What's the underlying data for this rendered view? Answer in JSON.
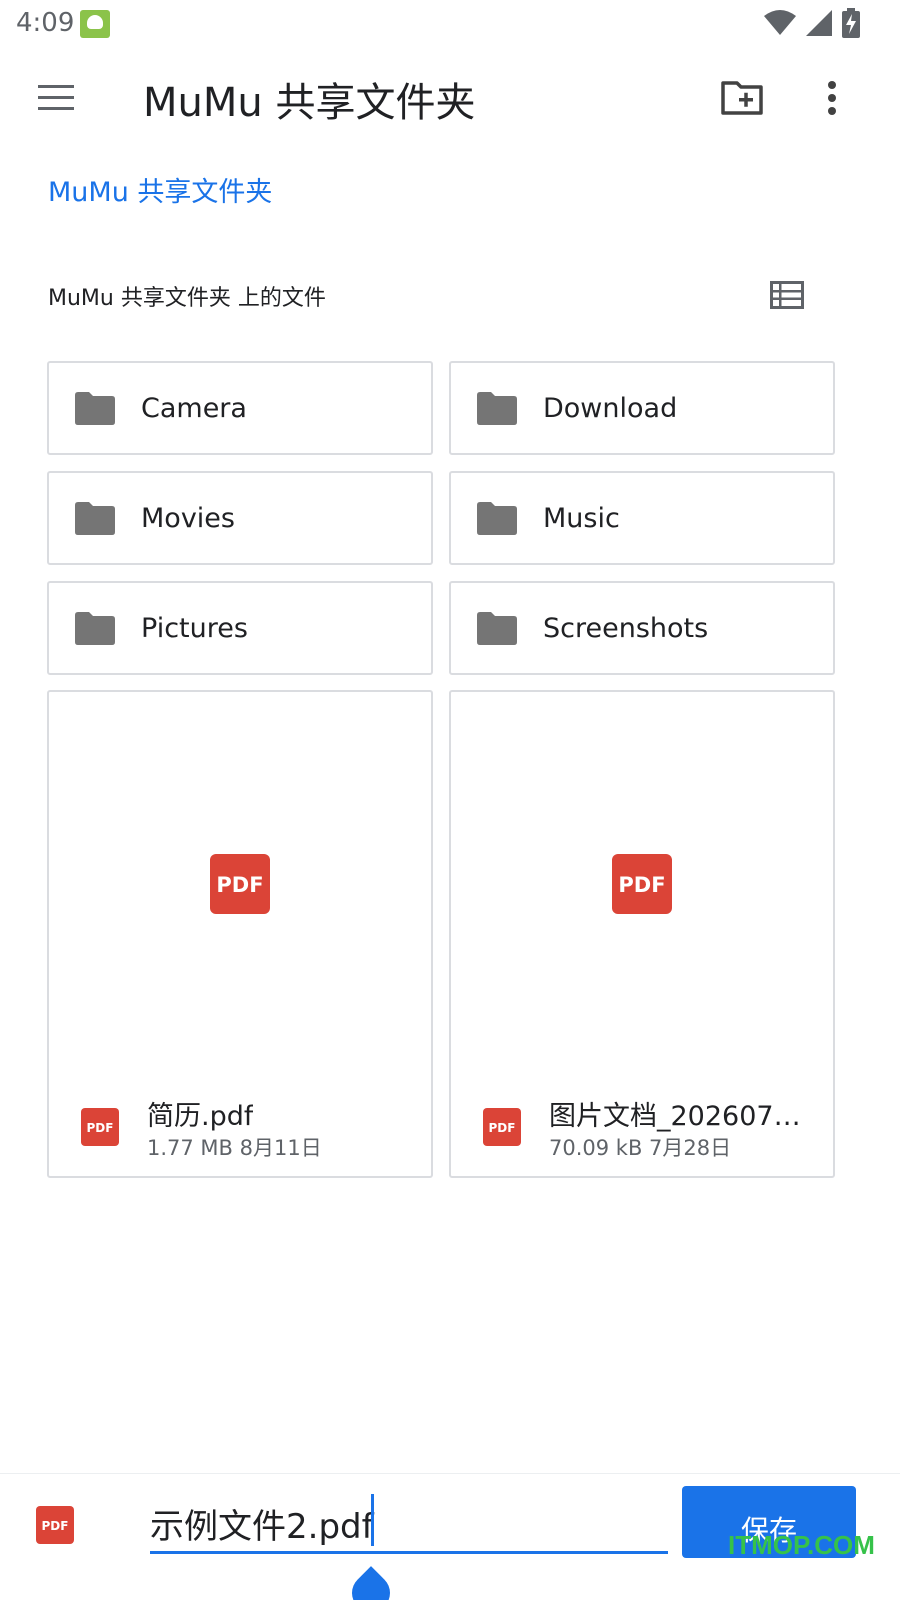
{
  "status_bar": {
    "time": "4:09"
  },
  "app_bar": {
    "title": "MuMu 共享文件夹"
  },
  "breadcrumb": {
    "current": "MuMu 共享文件夹"
  },
  "section": {
    "title": "MuMu 共享文件夹 上的文件"
  },
  "folders": [
    {
      "name": "Camera"
    },
    {
      "name": "Download"
    },
    {
      "name": "Movies"
    },
    {
      "name": "Music"
    },
    {
      "name": "Pictures"
    },
    {
      "name": "Screenshots"
    }
  ],
  "files": [
    {
      "name": "简历.pdf",
      "meta": "1.77 MB  8月11日",
      "badge": "PDF"
    },
    {
      "name": "图片文档_2026072...",
      "meta": "70.09 kB  7月28日",
      "badge": "PDF"
    }
  ],
  "save_bar": {
    "filename": "示例文件2.pdf",
    "save_label": "保存",
    "badge": "PDF"
  },
  "watermark": "ITMOP.COM",
  "colors": {
    "accent": "#1a73e8",
    "pdf_red": "#db4437",
    "folder_gray": "#757575",
    "border": "#dadce0"
  }
}
